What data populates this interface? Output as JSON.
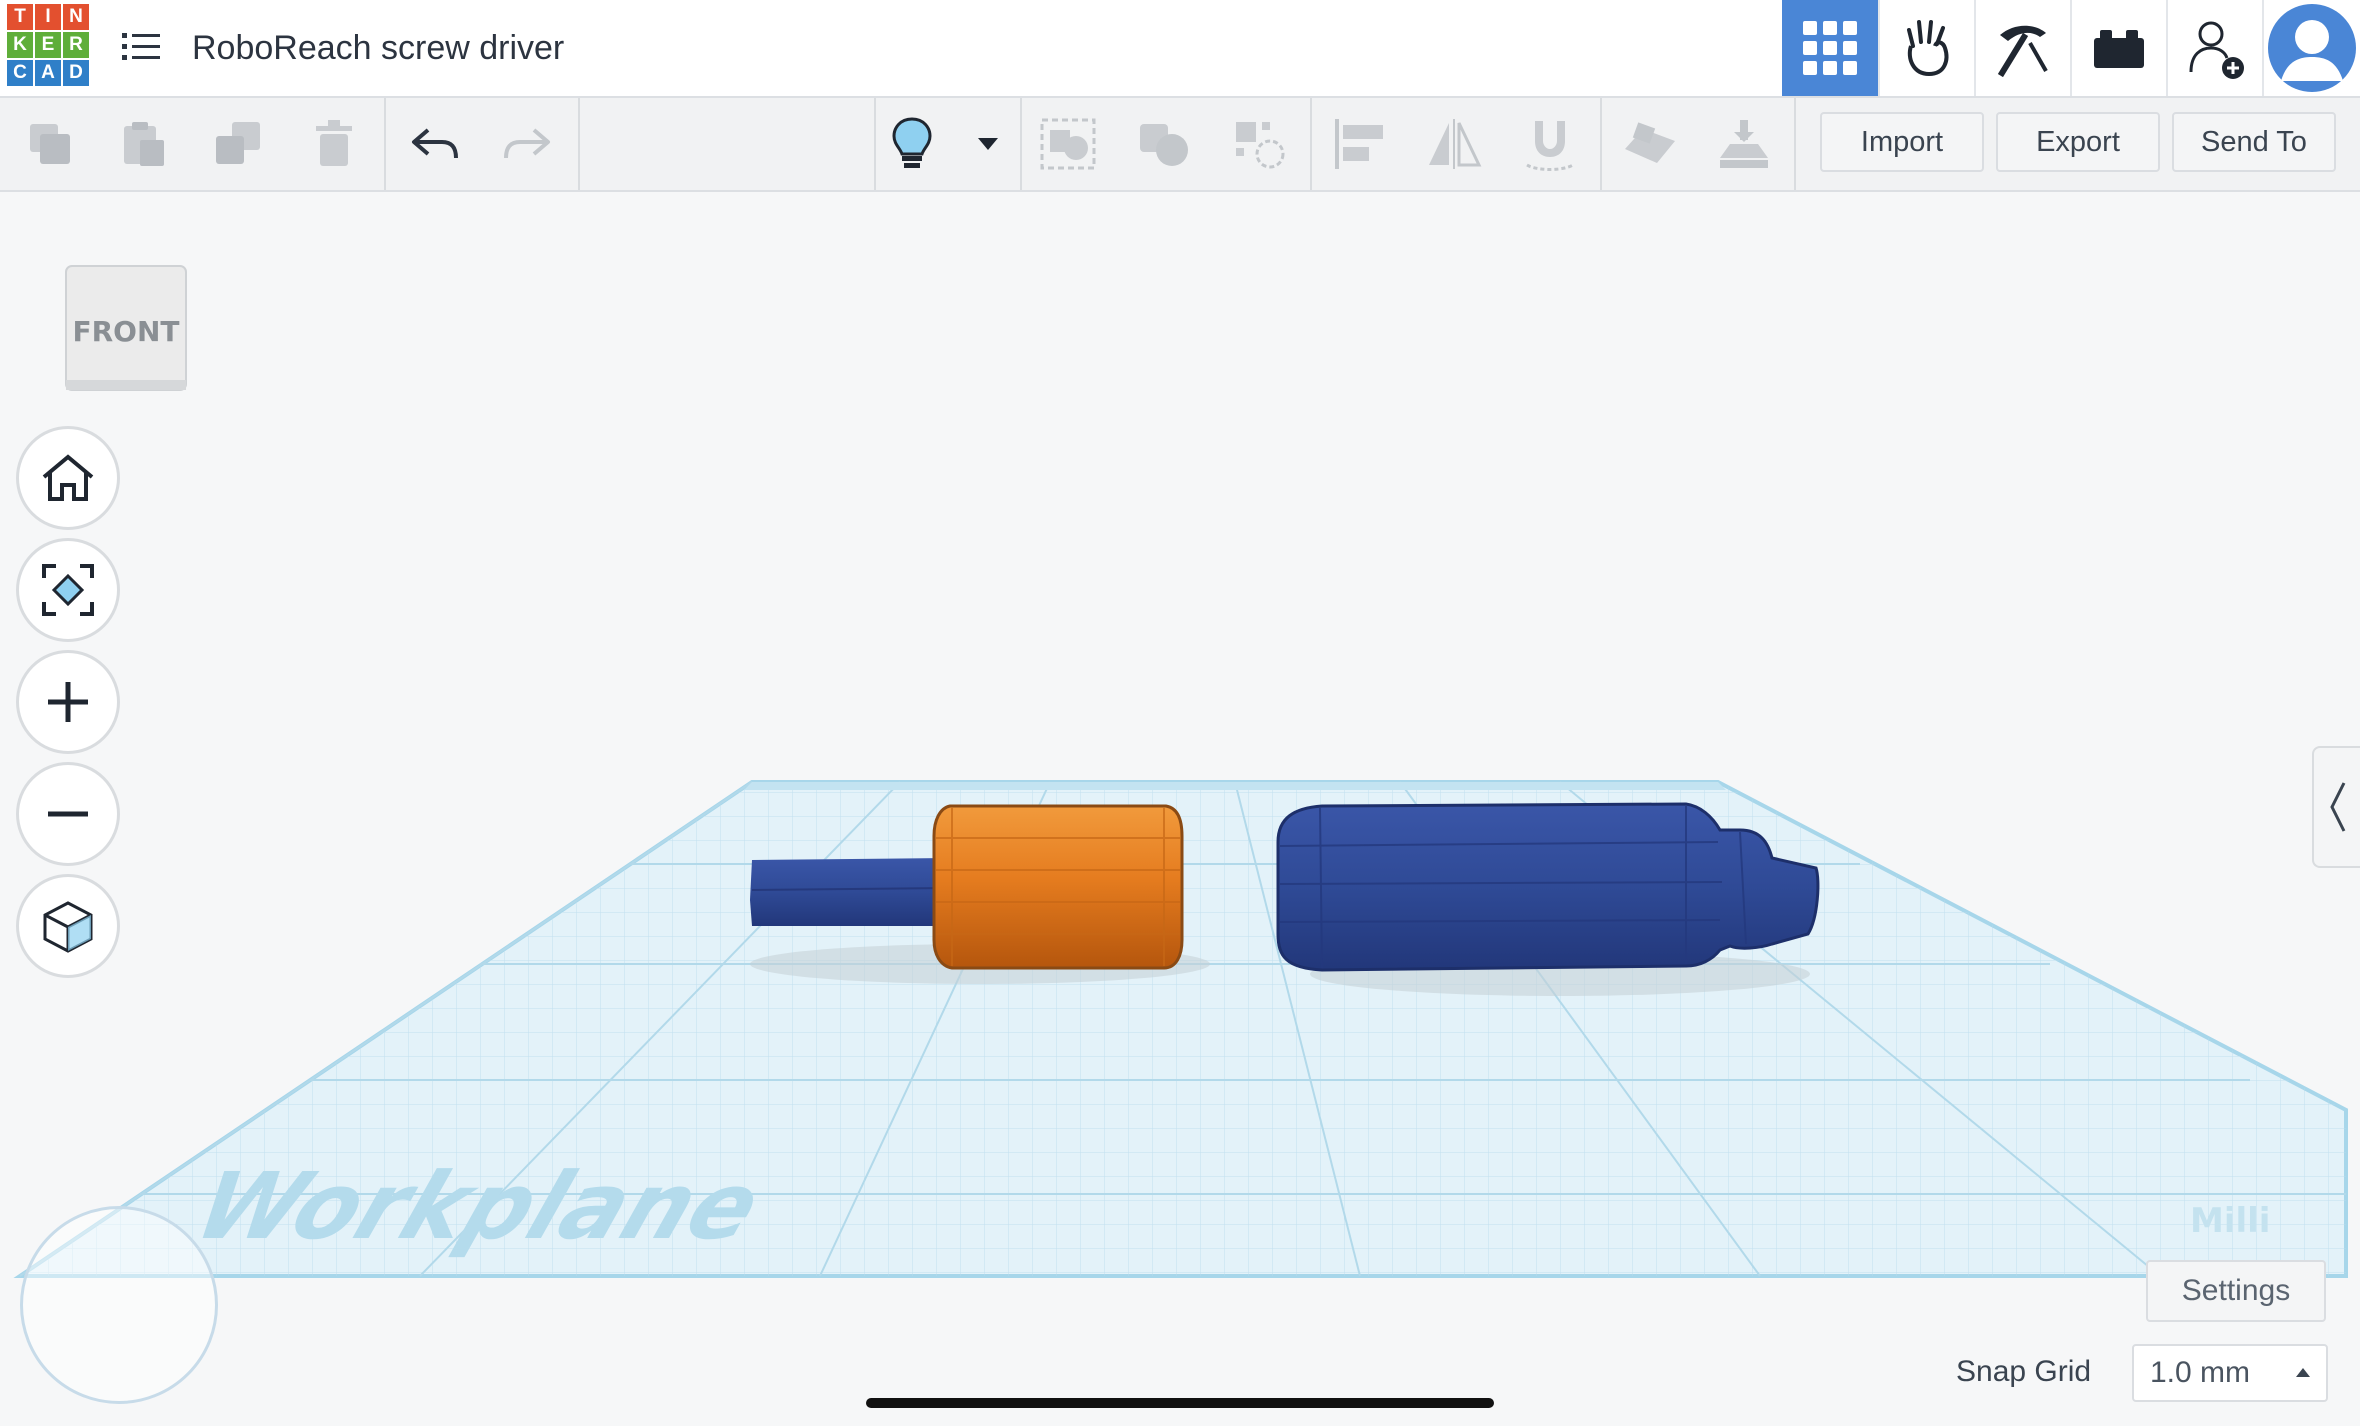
{
  "app": {
    "logo_letters": [
      "T",
      "I",
      "N",
      "K",
      "E",
      "R",
      "C",
      "A",
      "D"
    ],
    "logo_colors": [
      "#e3502f",
      "#e3502f",
      "#e3502f",
      "#5fae3a",
      "#5fae3a",
      "#5fae3a",
      "#2f7fc8",
      "#2f7fc8",
      "#2f7fc8"
    ],
    "title": "RoboReach screw driver"
  },
  "header": {
    "icons": [
      "grid-view-icon",
      "tinker-hand-icon",
      "pickaxe-icon",
      "brick-icon",
      "add-user-icon",
      "avatar"
    ],
    "active_view": "grid-view",
    "accent": "#4a86d6"
  },
  "toolbar": {
    "import_label": "Import",
    "export_label": "Export",
    "send_to_label": "Send To"
  },
  "viewcube": {
    "face_label": "FRONT"
  },
  "nav": [
    "home-view",
    "fit-all",
    "zoom-in",
    "zoom-out",
    "perspective"
  ],
  "scene": {
    "workplane_label": "Workplane",
    "units_label": "Milli",
    "shape_colors": {
      "orange": "#e57c1f",
      "blue": "#2f4a96"
    }
  },
  "footer": {
    "settings_label": "Settings",
    "snap_grid_label": "Snap Grid",
    "snap_grid_value": "1.0 mm"
  }
}
